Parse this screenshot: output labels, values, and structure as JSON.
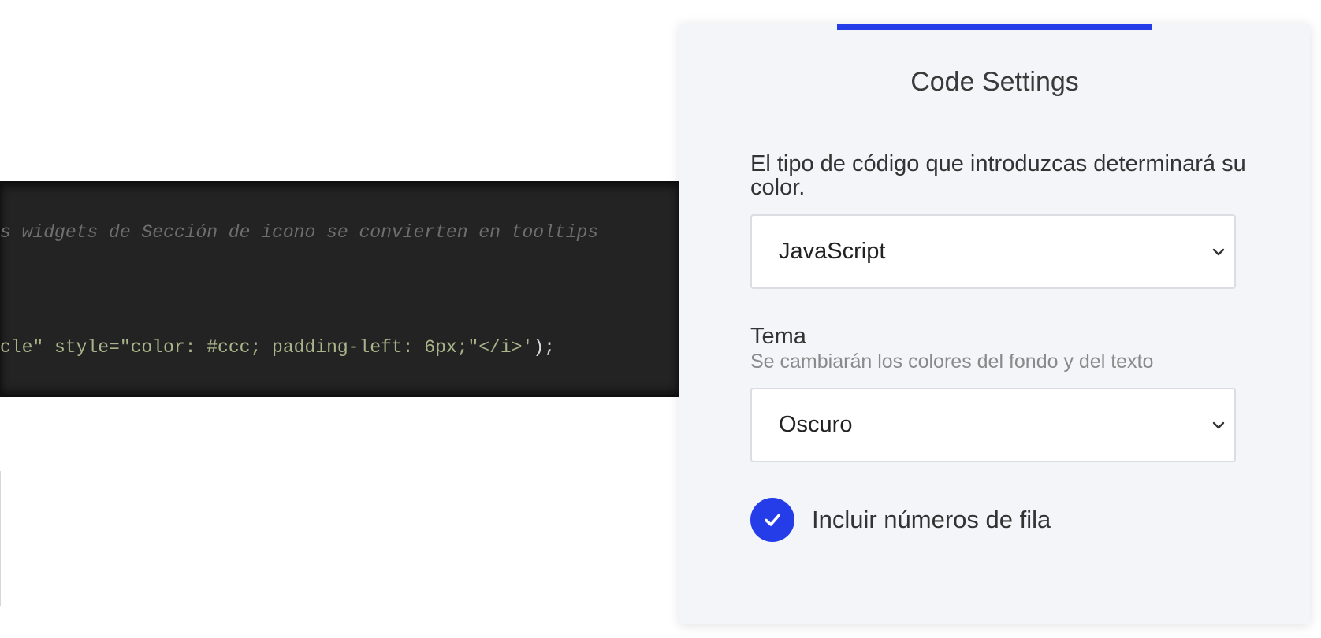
{
  "code_editor": {
    "comment_line": "s widgets de Sección de icono se convierten en tooltips",
    "statement_line": {
      "code": "cle\" style=\"color: #ccc; padding-left: 6px;\"</i>'",
      "tail": ");"
    }
  },
  "settings": {
    "title": "Code Settings",
    "language": {
      "label": "El tipo de código que introduzcas determinará su color.",
      "selected": "JavaScript",
      "icon": "chevron-down-icon"
    },
    "theme": {
      "label": "Tema",
      "hint": "Se cambiarán los colores del fondo y del texto",
      "selected": "Oscuro",
      "icon": "chevron-down-icon"
    },
    "line_numbers": {
      "label": "Incluir números de fila",
      "checked": true,
      "icon": "checkmark-icon"
    }
  },
  "colors": {
    "accent": "#243de8",
    "panel_background": "#f4f5f9",
    "editor_background": "#232323",
    "code_string": "#a9b48a",
    "code_comment": "#6e6e6e"
  }
}
